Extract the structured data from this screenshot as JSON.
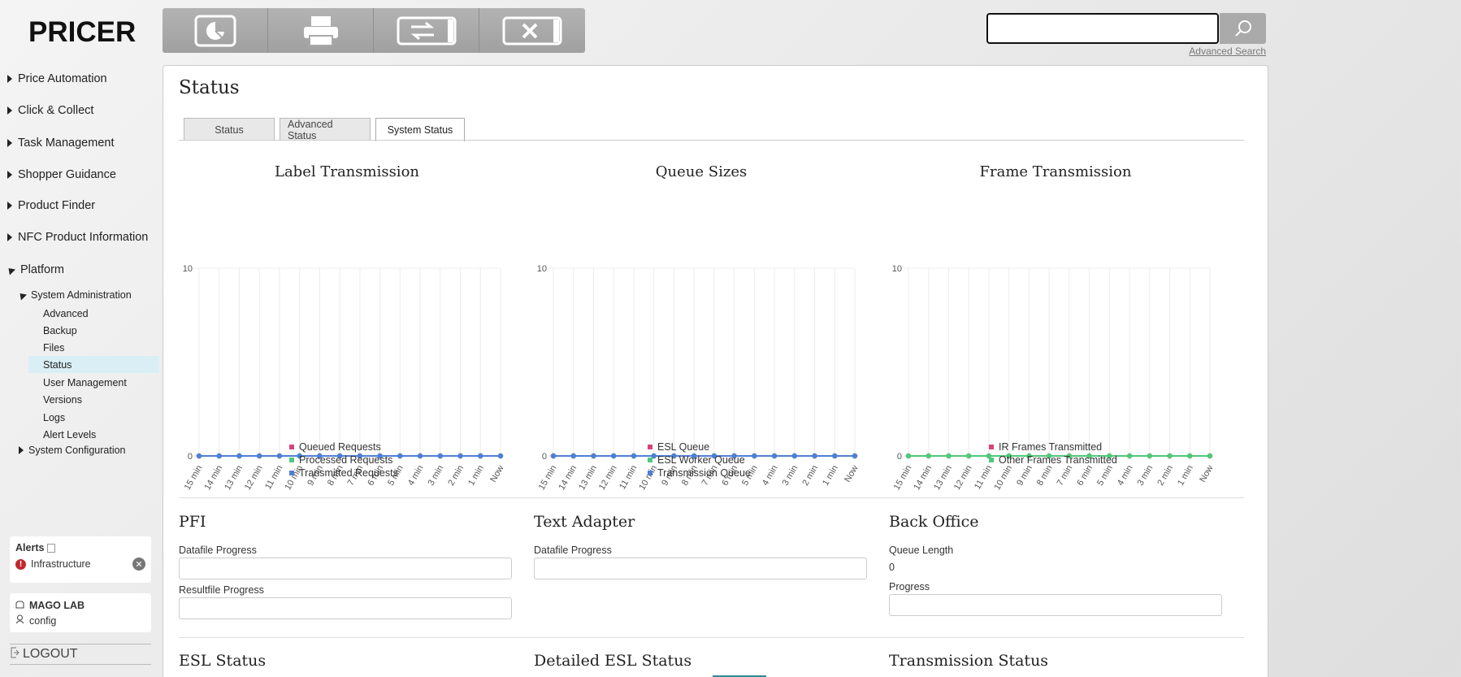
{
  "brand": "PRICER",
  "sidebar": {
    "main_items": [
      {
        "label": "Price Automation"
      },
      {
        "label": "Click & Collect"
      },
      {
        "label": "Task Management"
      },
      {
        "label": "Shopper Guidance"
      },
      {
        "label": "Product Finder"
      },
      {
        "label": "NFC Product Information"
      },
      {
        "label": "Platform"
      }
    ],
    "system_administration": {
      "label": "System Administration",
      "items": [
        "Advanced",
        "Backup",
        "Files",
        "Status",
        "User Management",
        "Versions",
        "Logs",
        "Alert Levels"
      ],
      "active": "Status"
    },
    "system_configuration": "System Configuration"
  },
  "alerts": {
    "title": "Alerts",
    "items": [
      {
        "label": "Infrastructure"
      }
    ]
  },
  "store": {
    "name": "MAGO LAB",
    "user": "config"
  },
  "logout_label": "LOGOUT",
  "toolbar": {
    "buttons": [
      "dashboard-icon",
      "printer-icon",
      "label-swap-icon",
      "label-remove-icon"
    ]
  },
  "search": {
    "value": "",
    "placeholder": "",
    "advanced_label": "Advanced Search"
  },
  "page": {
    "title": "Status",
    "tabs": [
      {
        "label": "Status",
        "active": false
      },
      {
        "label": "Advanced Status",
        "active": false
      },
      {
        "label": "System Status",
        "active": true
      }
    ]
  },
  "chart_data": [
    {
      "type": "line",
      "title": "Label Transmission",
      "x": [
        "15 min",
        "14 min",
        "13 min",
        "12 min",
        "11 min",
        "10 min",
        "9 min",
        "8 min",
        "7 min",
        "6 min",
        "5 min",
        "4 min",
        "3 min",
        "2 min",
        "1 min",
        "Now"
      ],
      "ylim": [
        0,
        10
      ],
      "yticks": [
        "10",
        "0"
      ],
      "grid": true,
      "legend": "bottom",
      "series": [
        {
          "name": "Queued Requests",
          "color": "#d6447b",
          "values": [
            0,
            0,
            0,
            0,
            0,
            0,
            0,
            0,
            0,
            0,
            0,
            0,
            0,
            0,
            0,
            0
          ]
        },
        {
          "name": "Processed Requests",
          "color": "#4fc97a",
          "values": [
            0,
            0,
            0,
            0,
            0,
            0,
            0,
            0,
            0,
            0,
            0,
            0,
            0,
            0,
            0,
            0
          ]
        },
        {
          "name": "Transmitted Requests",
          "color": "#4f7fd6",
          "values": [
            0,
            0,
            0,
            0,
            0,
            0,
            0,
            0,
            0,
            0,
            0,
            0,
            0,
            0,
            0,
            0
          ]
        }
      ]
    },
    {
      "type": "line",
      "title": "Queue Sizes",
      "x": [
        "15 min",
        "14 min",
        "13 min",
        "12 min",
        "11 min",
        "10 min",
        "9 min",
        "8 min",
        "7 min",
        "6 min",
        "5 min",
        "4 min",
        "3 min",
        "2 min",
        "1 min",
        "Now"
      ],
      "ylim": [
        0,
        10
      ],
      "yticks": [
        "10",
        "0"
      ],
      "grid": true,
      "legend": "bottom",
      "series": [
        {
          "name": "ESL Queue",
          "color": "#d6447b",
          "values": [
            0,
            0,
            0,
            0,
            0,
            0,
            0,
            0,
            0,
            0,
            0,
            0,
            0,
            0,
            0,
            0
          ]
        },
        {
          "name": "ESL Worker Queue",
          "color": "#4fc97a",
          "values": [
            0,
            0,
            0,
            0,
            0,
            0,
            0,
            0,
            0,
            0,
            0,
            0,
            0,
            0,
            0,
            0
          ]
        },
        {
          "name": "Transmission Queue",
          "color": "#4f7fd6",
          "values": [
            0,
            0,
            0,
            0,
            0,
            0,
            0,
            0,
            0,
            0,
            0,
            0,
            0,
            0,
            0,
            0
          ]
        }
      ]
    },
    {
      "type": "line",
      "title": "Frame Transmission",
      "x": [
        "15 min",
        "14 min",
        "13 min",
        "12 min",
        "11 min",
        "10 min",
        "9 min",
        "8 min",
        "7 min",
        "6 min",
        "5 min",
        "4 min",
        "3 min",
        "2 min",
        "1 min",
        "Now"
      ],
      "ylim": [
        0,
        10
      ],
      "yticks": [
        "10",
        "0"
      ],
      "grid": true,
      "legend": "bottom",
      "series": [
        {
          "name": "IR Frames Transmitted",
          "color": "#d6447b",
          "values": [
            0,
            0,
            0,
            0,
            0,
            0,
            0,
            0,
            0,
            0,
            0,
            0,
            0,
            0,
            0,
            0
          ]
        },
        {
          "name": "Other Frames Transmitted",
          "color": "#4fc97a",
          "values": [
            0,
            0,
            0,
            0,
            0,
            0,
            0,
            0,
            0,
            0,
            0,
            0,
            0,
            0,
            0,
            0
          ]
        }
      ]
    }
  ],
  "pfi": {
    "title": "PFI",
    "datafile_label": "Datafile Progress",
    "resultfile_label": "Resultfile Progress"
  },
  "text_adapter": {
    "title": "Text Adapter",
    "datafile_label": "Datafile Progress"
  },
  "back_office": {
    "title": "Back Office",
    "queue_label": "Queue Length",
    "queue_value": "0",
    "progress_label": "Progress"
  },
  "bottom_sections": {
    "esl_status": "ESL Status",
    "detailed_esl_status": "Detailed ESL Status",
    "transmission_status": "Transmission Status"
  }
}
